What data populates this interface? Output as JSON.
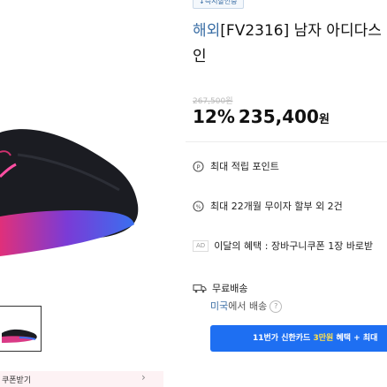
{
  "product": {
    "badge": "↓즉시할인중",
    "brand": "해외",
    "title_rest": "[FV2316] 남자 아디다스",
    "title_line2": "인",
    "original_price": "267,500원",
    "discount": "12%",
    "price": "235,400",
    "price_unit": "원"
  },
  "benefits": {
    "points": "최대 적립 포인트",
    "installment": "최대 22개월 무이자 할부 외 2건",
    "ad_label": "AD",
    "event": "이달의 혜택 : 장바구니쿠폰 1장 바로받"
  },
  "shipping": {
    "label": "무료배송",
    "origin": "미국",
    "origin_suffix": "에서 배송",
    "help": "?"
  },
  "card_promo": {
    "prefix": "11번가 신한카드",
    "highlight": "3만원",
    "suffix": "혜택 + 최대"
  },
  "coupon_bar": {
    "label": "쿠폰받기",
    "chevron": "›"
  },
  "colors": {
    "accent": "#1e6ff2",
    "brand_link": "#3a6ea5",
    "text": "#111111"
  }
}
